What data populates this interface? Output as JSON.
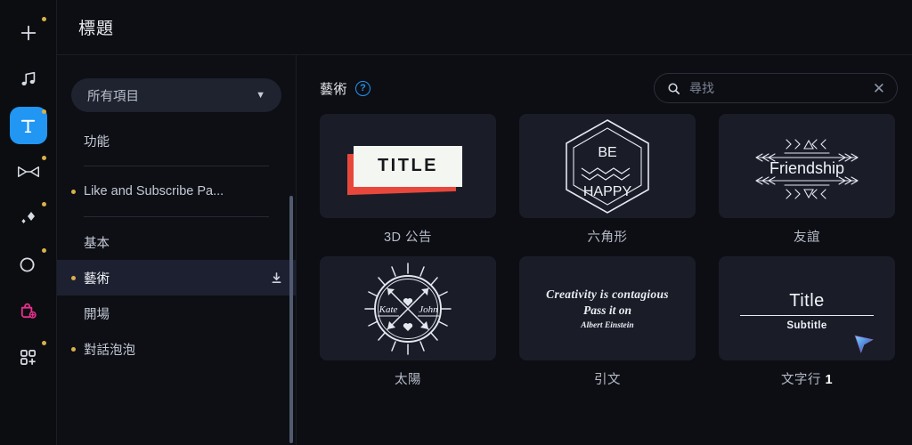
{
  "window": {
    "title": "標題"
  },
  "rail": {
    "items": [
      {
        "name": "add-media",
        "icon": "plus-icon",
        "badge": true,
        "active": false
      },
      {
        "name": "audio",
        "icon": "music-note-icon",
        "badge": false,
        "active": false
      },
      {
        "name": "text",
        "icon": "text-t-icon",
        "badge": true,
        "active": true
      },
      {
        "name": "transition",
        "icon": "transition-bowtie-icon",
        "badge": true,
        "active": false
      },
      {
        "name": "effects",
        "icon": "sparkle-diamond-icon",
        "badge": true,
        "active": false
      },
      {
        "name": "filters",
        "icon": "filter-moon-icon",
        "badge": true,
        "active": false
      },
      {
        "name": "stickers",
        "icon": "sticker-bag-plus-icon",
        "badge": false,
        "active": false
      },
      {
        "name": "plugins",
        "icon": "grid-plus-icon",
        "badge": true,
        "active": false
      }
    ]
  },
  "category_panel": {
    "dropdown": {
      "value": "所有項目",
      "chevron": "chevron-down-icon"
    },
    "items": [
      {
        "label": "功能",
        "bullet": false,
        "selected": false,
        "download": false
      },
      {
        "divider_after": true
      },
      {
        "label": "Like and Subscribe Pa...",
        "bullet": true,
        "selected": false,
        "download": false
      },
      {
        "divider_after": true
      },
      {
        "label": "基本",
        "bullet": false,
        "selected": false,
        "download": false
      },
      {
        "label": "藝術",
        "bullet": true,
        "selected": true,
        "download": true
      },
      {
        "label": "開場",
        "bullet": false,
        "selected": false,
        "download": false
      },
      {
        "label": "對話泡泡",
        "bullet": true,
        "selected": false,
        "download": false
      }
    ]
  },
  "content": {
    "title": "藝術",
    "help_icon": "help-circle-icon",
    "search": {
      "placeholder": "尋找",
      "value": "",
      "icon": "search-icon",
      "clear_icon": "close-x-icon"
    },
    "cards": [
      {
        "label": "3D 公告",
        "label_suffix": "",
        "preview_kind": "3d-title",
        "preview_text": "TITLE"
      },
      {
        "label": "六角形",
        "label_suffix": "",
        "preview_kind": "hexagon",
        "preview_line1": "BE",
        "preview_line2": "HAPPY"
      },
      {
        "label": "友誼",
        "label_suffix": "",
        "preview_kind": "friendship",
        "preview_text": "Friendship"
      },
      {
        "label": "太陽",
        "label_suffix": "",
        "preview_kind": "sun",
        "preview_name1": "Kate",
        "preview_name2": "John"
      },
      {
        "label": "引文",
        "label_suffix": "",
        "preview_kind": "quote",
        "quote_line1": "Creativity is contagious",
        "quote_line2": "Pass it on",
        "quote_author": "Albert Einstein"
      },
      {
        "label": "文字行 ",
        "label_suffix": "1",
        "preview_kind": "title-subtitle",
        "preview_title": "Title",
        "preview_subtitle": "Subtitle"
      }
    ]
  },
  "colors": {
    "accent": "#2196f3",
    "badge": "#d8b14a",
    "sticker": "#e8308c",
    "selected_row": "#1d2030",
    "panel_bg": "#0e0f14",
    "card_bg": "#1a1d28"
  }
}
